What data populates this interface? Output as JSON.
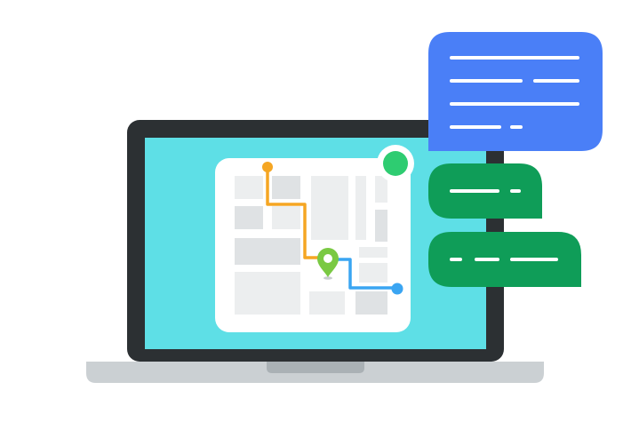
{
  "illustration": {
    "subject": "laptop-with-route-map-and-chat-bubbles",
    "icons": {
      "laptop": "laptop-icon",
      "map": "map-icon",
      "route": "route-icon",
      "location_pin": "location-pin-icon",
      "status_dot": "online-status-icon",
      "chat_bubbles": "chat-bubble-icon"
    },
    "colors": {
      "background": "#ffffff",
      "laptop_frame": "#2c3033",
      "laptop_base": "#cbd0d3",
      "laptop_base_notch": "#aab1b5",
      "screen": "#5edfe6",
      "map_card": "#ffffff",
      "map_block": "#eceeef",
      "map_block_dark": "#dfe2e4",
      "route_orange": "#f5a623",
      "route_blue": "#3aa5f2",
      "pin_green": "#7ac943",
      "status_green": "#2ecc71",
      "bubble_blue": "#4a7ff7",
      "bubble_green": "#0f9d58",
      "bubble_text_line": "#ffffff"
    }
  }
}
